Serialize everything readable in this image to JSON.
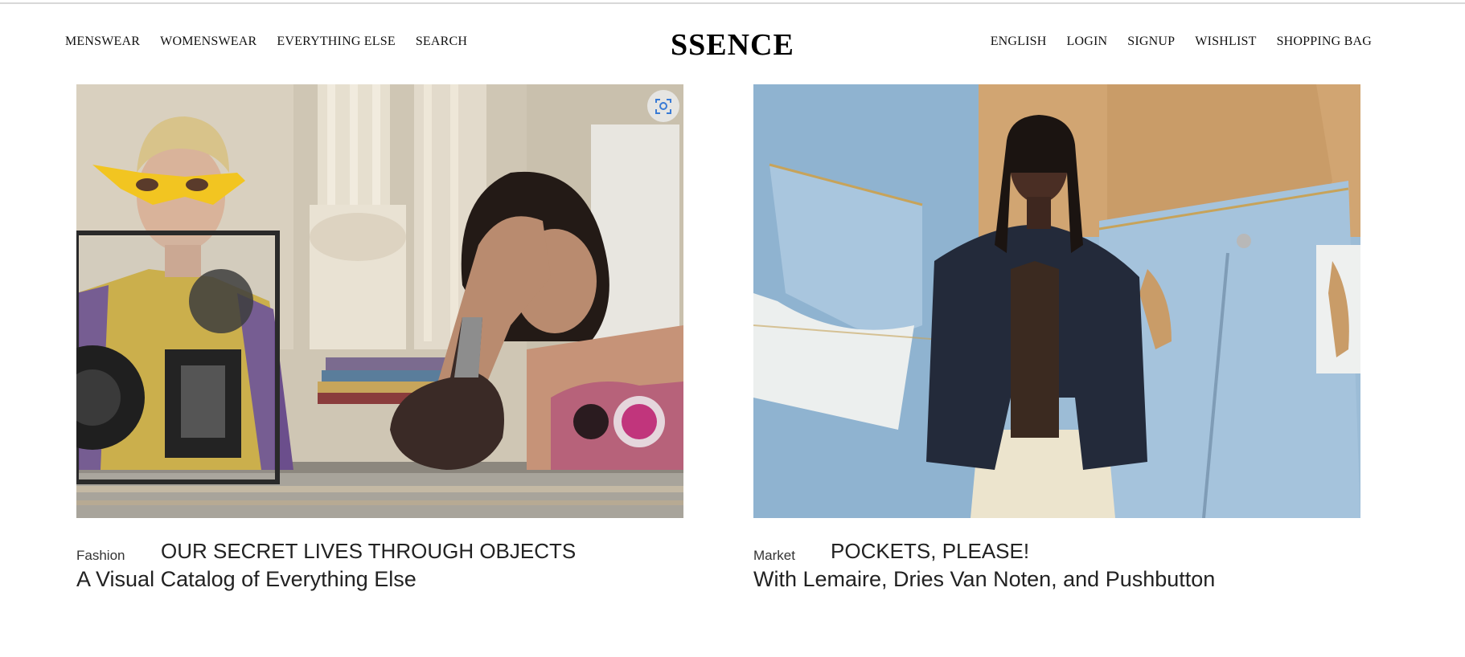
{
  "header": {
    "logo": "SSENCE",
    "nav_left": [
      "MENSWEAR",
      "WOMENSWEAR",
      "EVERYTHING ELSE",
      "SEARCH"
    ],
    "nav_right": [
      "ENGLISH",
      "LOGIN",
      "SIGNUP",
      "WISHLIST",
      "SHOPPING BAG"
    ]
  },
  "cards": [
    {
      "category": "Fashion",
      "headline": "OUR SECRET LIVES THROUGH OBJECTS",
      "subline": "A Visual Catalog of Everything Else",
      "image_icon": "visual-search-icon"
    },
    {
      "category": "Market",
      "headline": "POCKETS, PLEASE!",
      "subline": "With Lemaire, Dries Van Noten, and Pushbutton"
    }
  ],
  "colors": {
    "text": "#222222",
    "lens_icon": "#3a7bd5"
  }
}
